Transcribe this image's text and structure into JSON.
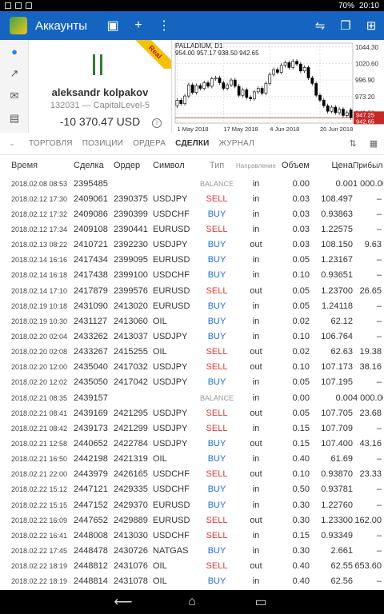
{
  "statusbar": {
    "battery": "70%",
    "time": "20:10"
  },
  "appbar": {
    "title": "Аккаунты"
  },
  "account": {
    "badge": "Real",
    "name": "aleksandr kolpakov",
    "number_server": "132031 — CapitalLevel-5",
    "balance": "-10 370.47 USD",
    "info": "i"
  },
  "chart": {
    "title": "PALLADIUM, D1",
    "ohlc": "954.00 957.17 938.50 942.65",
    "bid_label": "942.65",
    "price_line_label": "947.25"
  },
  "chart_data": {
    "type": "candlestick",
    "title": "PALLADIUM, D1",
    "x_ticks": [
      "1 May 2018",
      "17 May 2018",
      "4 Jun 2018",
      "20 Jun 2018"
    ],
    "y_ticks": [
      1044.3,
      1020.6,
      996.9,
      973.2,
      949.5
    ],
    "ylim": [
      935,
      1050
    ],
    "current_price": 942.65,
    "closes": [
      968,
      963,
      974,
      990,
      979,
      989,
      985,
      993,
      988,
      999,
      1000,
      993,
      985,
      990,
      997,
      988,
      975,
      983,
      972,
      970,
      980,
      985,
      978,
      992,
      1005,
      1012,
      1008,
      1018,
      1022,
      1015,
      1024,
      1020,
      1010,
      1015,
      1000,
      992,
      975,
      968,
      960,
      952,
      958,
      950,
      955,
      946,
      950,
      942.65
    ],
    "opens": [
      960,
      968,
      963,
      974,
      990,
      979,
      989,
      985,
      993,
      988,
      999,
      1000,
      993,
      985,
      990,
      997,
      988,
      975,
      983,
      972,
      970,
      980,
      985,
      978,
      992,
      1005,
      1012,
      1008,
      1018,
      1022,
      1015,
      1024,
      1020,
      1010,
      1015,
      1000,
      992,
      975,
      968,
      960,
      952,
      958,
      950,
      955,
      946,
      954
    ]
  },
  "tabs": {
    "items": [
      "ТОРГОВЛЯ",
      "ПОЗИЦИИ",
      "ОРДЕРА",
      "СДЕЛКИ",
      "ЖУРНАЛ"
    ]
  },
  "table": {
    "headers": {
      "time": "Время",
      "deal": "Сделка",
      "order": "Ордер",
      "symbol": "Символ",
      "type": "Тип",
      "direction": "Направление",
      "volume": "Объем",
      "price": "Цена",
      "profit": "Прибыль"
    },
    "rows": [
      {
        "time": "2018.02.08 08:53",
        "deal": "2395485",
        "order": "",
        "symbol": "",
        "type": "BALANCE",
        "dir": "in",
        "vol": "0.00",
        "price": "0.00",
        "profit": "1 000.00"
      },
      {
        "time": "2018.02.12 17:30",
        "deal": "2409061",
        "order": "2390375",
        "symbol": "USDJPY",
        "type": "SELL",
        "dir": "in",
        "vol": "0.03",
        "price": "108.497",
        "profit": "–"
      },
      {
        "time": "2018.02.12 17:32",
        "deal": "2409086",
        "order": "2390399",
        "symbol": "USDCHF",
        "type": "BUY",
        "dir": "in",
        "vol": "0.03",
        "price": "0.93863",
        "profit": "–"
      },
      {
        "time": "2018.02.12 17:34",
        "deal": "2409108",
        "order": "2390441",
        "symbol": "EURUSD",
        "type": "SELL",
        "dir": "in",
        "vol": "0.03",
        "price": "1.22575",
        "profit": "–"
      },
      {
        "time": "2018.02.13 08:22",
        "deal": "2410721",
        "order": "2392230",
        "symbol": "USDJPY",
        "type": "BUY",
        "dir": "out",
        "vol": "0.03",
        "price": "108.150",
        "profit": "9.63"
      },
      {
        "time": "2018.02.14 16:16",
        "deal": "2417434",
        "order": "2399095",
        "symbol": "EURUSD",
        "type": "BUY",
        "dir": "in",
        "vol": "0.05",
        "price": "1.23167",
        "profit": "–"
      },
      {
        "time": "2018.02.14 16:18",
        "deal": "2417438",
        "order": "2399100",
        "symbol": "USDCHF",
        "type": "BUY",
        "dir": "in",
        "vol": "0.10",
        "price": "0.93651",
        "profit": "–"
      },
      {
        "time": "2018.02.14 17:10",
        "deal": "2417879",
        "order": "2399576",
        "symbol": "EURUSD",
        "type": "SELL",
        "dir": "out",
        "vol": "0.05",
        "price": "1.23700",
        "profit": "26.65"
      },
      {
        "time": "2018.02.19 10:18",
        "deal": "2431090",
        "order": "2413020",
        "symbol": "EURUSD",
        "type": "BUY",
        "dir": "in",
        "vol": "0.05",
        "price": "1.24118",
        "profit": "–"
      },
      {
        "time": "2018.02.19 10:30",
        "deal": "2431127",
        "order": "2413060",
        "symbol": "OIL",
        "type": "BUY",
        "dir": "in",
        "vol": "0.02",
        "price": "62.12",
        "profit": "–"
      },
      {
        "time": "2018.02.20 02:04",
        "deal": "2433262",
        "order": "2413037",
        "symbol": "USDJPY",
        "type": "BUY",
        "dir": "in",
        "vol": "0.10",
        "price": "106.764",
        "profit": "–"
      },
      {
        "time": "2018.02.20 02:08",
        "deal": "2433267",
        "order": "2415255",
        "symbol": "OIL",
        "type": "SELL",
        "dir": "out",
        "vol": "0.02",
        "price": "62.63",
        "profit": "19.38"
      },
      {
        "time": "2018.02.20 12:00",
        "deal": "2435040",
        "order": "2417032",
        "symbol": "USDJPY",
        "type": "SELL",
        "dir": "out",
        "vol": "0.10",
        "price": "107.173",
        "profit": "38.16"
      },
      {
        "time": "2018.02.20 12:02",
        "deal": "2435050",
        "order": "2417042",
        "symbol": "USDJPY",
        "type": "BUY",
        "dir": "in",
        "vol": "0.05",
        "price": "107.195",
        "profit": "–"
      },
      {
        "time": "2018.02.21 08:35",
        "deal": "2439157",
        "order": "",
        "symbol": "",
        "type": "BALANCE",
        "dir": "in",
        "vol": "0.00",
        "price": "0.00",
        "profit": "4 000.00"
      },
      {
        "time": "2018.02.21 08:41",
        "deal": "2439169",
        "order": "2421295",
        "symbol": "USDJPY",
        "type": "SELL",
        "dir": "out",
        "vol": "0.05",
        "price": "107.705",
        "profit": "23.68"
      },
      {
        "time": "2018.02.21 08:42",
        "deal": "2439173",
        "order": "2421299",
        "symbol": "USDJPY",
        "type": "SELL",
        "dir": "in",
        "vol": "0.15",
        "price": "107.709",
        "profit": "–"
      },
      {
        "time": "2018.02.21 12:58",
        "deal": "2440652",
        "order": "2422784",
        "symbol": "USDJPY",
        "type": "BUY",
        "dir": "out",
        "vol": "0.15",
        "price": "107.400",
        "profit": "43.16"
      },
      {
        "time": "2018.02.21 16:50",
        "deal": "2442198",
        "order": "2421319",
        "symbol": "OIL",
        "type": "BUY",
        "dir": "in",
        "vol": "0.40",
        "price": "61.69",
        "profit": "–"
      },
      {
        "time": "2018.02.21 22:00",
        "deal": "2443979",
        "order": "2426165",
        "symbol": "USDCHF",
        "type": "SELL",
        "dir": "out",
        "vol": "0.10",
        "price": "0.93870",
        "profit": "23.33"
      },
      {
        "time": "2018.02.22 15:12",
        "deal": "2447121",
        "order": "2429335",
        "symbol": "USDCHF",
        "type": "BUY",
        "dir": "in",
        "vol": "0.50",
        "price": "0.93781",
        "profit": "–"
      },
      {
        "time": "2018.02.22 15:15",
        "deal": "2447152",
        "order": "2429370",
        "symbol": "EURUSD",
        "type": "BUY",
        "dir": "in",
        "vol": "0.30",
        "price": "1.22760",
        "profit": "–"
      },
      {
        "time": "2018.02.22 16:09",
        "deal": "2447652",
        "order": "2429889",
        "symbol": "EURUSD",
        "type": "SELL",
        "dir": "out",
        "vol": "0.30",
        "price": "1.23300",
        "profit": "162.00"
      },
      {
        "time": "2018.02.22 16:41",
        "deal": "2448008",
        "order": "2413030",
        "symbol": "USDCHF",
        "type": "SELL",
        "dir": "in",
        "vol": "0.15",
        "price": "0.93349",
        "profit": "–"
      },
      {
        "time": "2018.02.22 17:45",
        "deal": "2448478",
        "order": "2430726",
        "symbol": "NATGAS",
        "type": "BUY",
        "dir": "in",
        "vol": "0.30",
        "price": "2.661",
        "profit": "–"
      },
      {
        "time": "2018.02.22 18:19",
        "deal": "2448812",
        "order": "2431076",
        "symbol": "OIL",
        "type": "SELL",
        "dir": "out",
        "vol": "0.40",
        "price": "62.55",
        "profit": "653.60"
      },
      {
        "time": "2018.02.22 18:19",
        "deal": "2448814",
        "order": "2431078",
        "symbol": "OIL",
        "type": "BUY",
        "dir": "in",
        "vol": "0.40",
        "price": "62.56",
        "profit": "–"
      }
    ]
  },
  "colors": {
    "appbar": "#1565c0",
    "buy": "#1e6fd9",
    "sell": "#e53935",
    "chart_line": "#c62828"
  }
}
